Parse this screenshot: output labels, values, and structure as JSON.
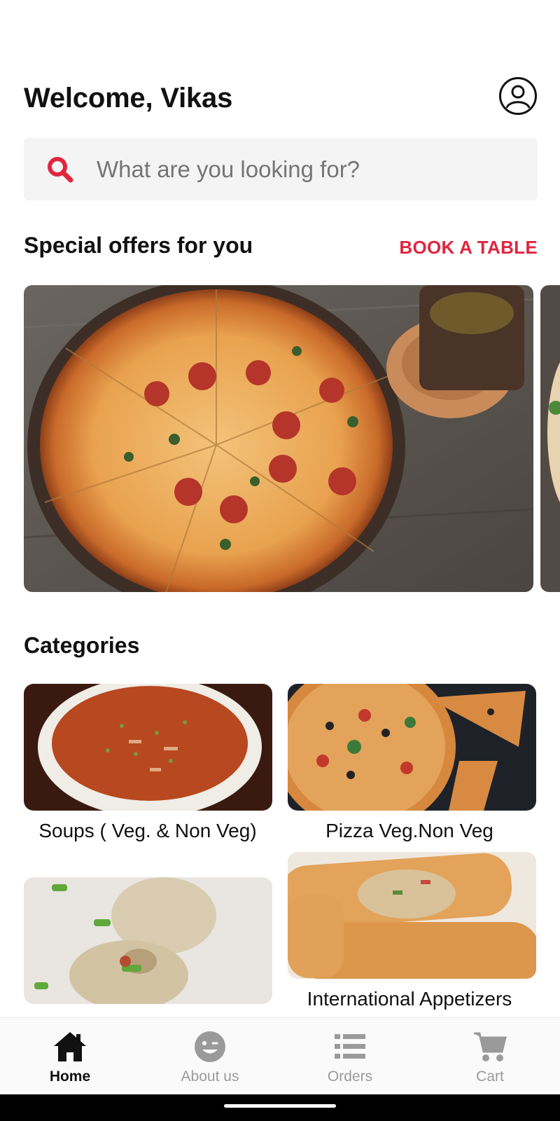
{
  "header": {
    "welcome": "Welcome, Vikas"
  },
  "search": {
    "placeholder": "What are you looking for?"
  },
  "offers": {
    "title": "Special offers for you",
    "action": "BOOK A TABLE"
  },
  "categories": {
    "title": "Categories",
    "items": [
      {
        "label": "Soups ( Veg. & Non Veg)"
      },
      {
        "label": "Pizza Veg.Non Veg"
      },
      {
        "label": ""
      },
      {
        "label": "International Appetizers"
      }
    ]
  },
  "nav": [
    {
      "label": "Home",
      "icon": "home-icon",
      "active": true
    },
    {
      "label": "About us",
      "icon": "smiley-icon",
      "active": false
    },
    {
      "label": "Orders",
      "icon": "list-icon",
      "active": false
    },
    {
      "label": "Cart",
      "icon": "cart-icon",
      "active": false
    }
  ],
  "colors": {
    "accent": "#e0263f",
    "text": "#111111",
    "muted": "#9a9a9a"
  }
}
